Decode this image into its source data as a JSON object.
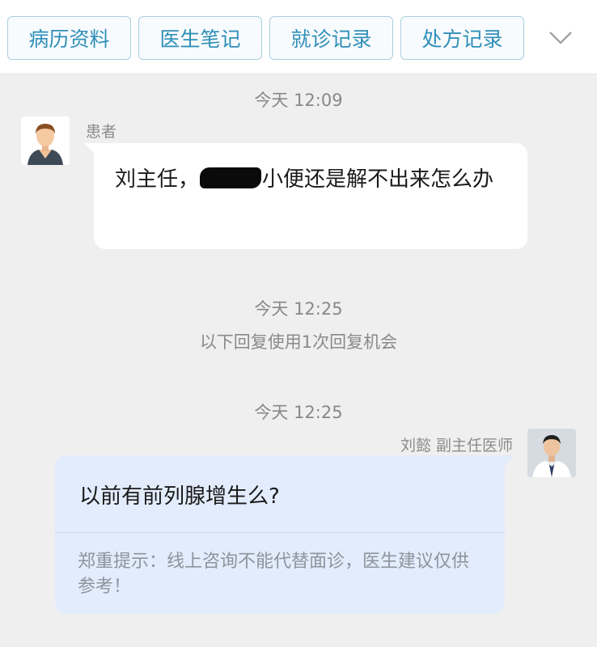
{
  "tabs": [
    {
      "label": "病历资料"
    },
    {
      "label": "医生笔记"
    },
    {
      "label": "就诊记录"
    },
    {
      "label": "处方记录"
    }
  ],
  "messages": {
    "time1": "今天 12:09",
    "patient": {
      "name": "患者",
      "text_before": "刘主任，",
      "text_after": "小便还是解不出来怎么办"
    },
    "time2": "今天 12:25",
    "reply_note": "以下回复使用1次回复机会",
    "time3": "今天 12:25",
    "doctor": {
      "name": "刘懿  副主任医师",
      "text": "以前有前列腺增生么?",
      "disclaimer": "郑重提示：线上咨询不能代替面诊，医生建议仅供参考！"
    }
  },
  "colors": {
    "accent": "#2f8fb8",
    "doctor_bubble": "#e2ecfc",
    "patient_bubble": "#ffffff",
    "background": "#efefef"
  },
  "icons": {
    "more": "chevron-down-icon",
    "patient_avatar": "patient-avatar-icon",
    "doctor_avatar": "doctor-avatar-photo"
  }
}
